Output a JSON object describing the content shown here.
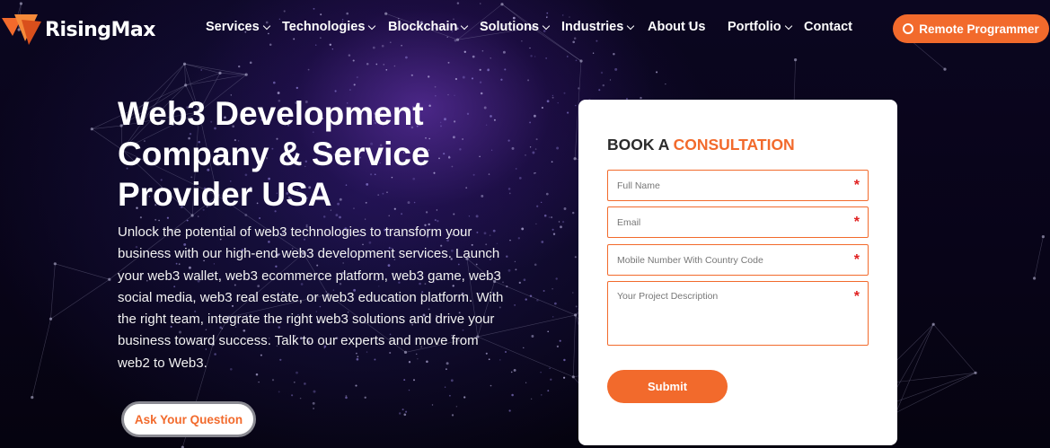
{
  "header": {
    "logo_text": "RisingMax",
    "nav": [
      {
        "label": "Services",
        "dropdown": true
      },
      {
        "label": "Technologies",
        "dropdown": true
      },
      {
        "label": "Blockchain",
        "dropdown": true
      },
      {
        "label": "Solutions",
        "dropdown": true
      },
      {
        "label": "Industries",
        "dropdown": true
      },
      {
        "label": "About Us",
        "dropdown": false
      },
      {
        "label": "Portfolio",
        "dropdown": true
      },
      {
        "label": "Contact",
        "dropdown": false
      }
    ],
    "cta_label": "Remote Programmer"
  },
  "hero": {
    "title_lines": [
      "Web3 Development",
      "Company & Service",
      "Provider USA"
    ],
    "description": "Unlock the potential of web3 technologies to transform your business with our high-end web3 development services. Launch your web3 wallet, web3 ecommerce platform, web3 game, web3 social media, web3 real estate, or web3 education platform. With the right team, integrate the right web3 solutions and drive your business toward success. Talk to our experts and move from web2 to Web3.",
    "ask_button": "Ask Your Question"
  },
  "form": {
    "title_prefix": "BOOK A",
    "title_accent": "CONSULTATION",
    "fields": [
      {
        "placeholder": "Full Name",
        "value": "",
        "required_mark": "*"
      },
      {
        "placeholder": "Email",
        "value": "",
        "required_mark": "*"
      },
      {
        "placeholder": "Mobile Number With Country Code",
        "value": "",
        "required_mark": "*"
      },
      {
        "placeholder": "Your Project Description",
        "value": "",
        "required_mark": "*"
      }
    ],
    "submit_label": "Submit"
  },
  "colors": {
    "accent": "#f26a2c",
    "background": "#07041a",
    "card": "#ffffff",
    "required": "#e02020"
  },
  "icons": [
    "risingmax-logo-icon",
    "chevron-down-icon",
    "ring-icon"
  ]
}
